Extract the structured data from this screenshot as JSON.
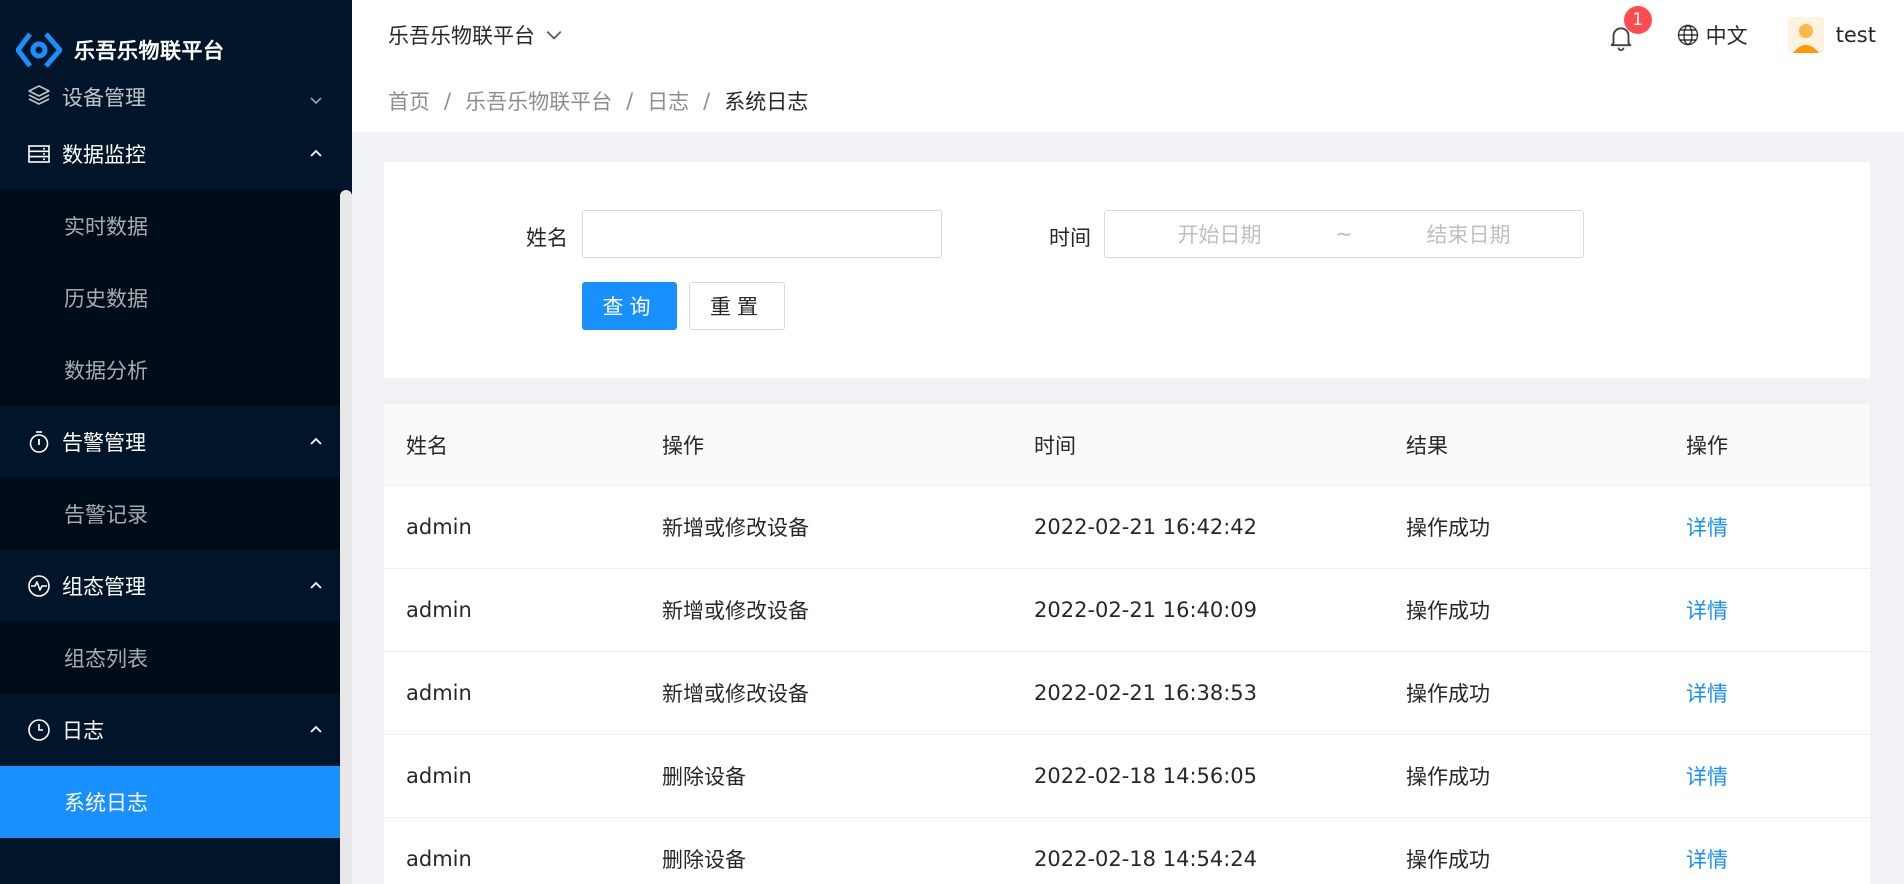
{
  "app": {
    "name": "乐吾乐物联平台"
  },
  "sidebar": {
    "groups": [
      {
        "label": "设备管理",
        "icon": "layers-icon",
        "open": false,
        "items": []
      },
      {
        "label": "数据监控",
        "icon": "database-icon",
        "open": true,
        "items": [
          {
            "label": "实时数据"
          },
          {
            "label": "历史数据"
          },
          {
            "label": "数据分析"
          }
        ]
      },
      {
        "label": "告警管理",
        "icon": "alert-icon",
        "open": true,
        "items": [
          {
            "label": "告警记录"
          }
        ]
      },
      {
        "label": "组态管理",
        "icon": "heartbeat-icon",
        "open": true,
        "items": [
          {
            "label": "组态列表"
          }
        ]
      },
      {
        "label": "日志",
        "icon": "clock-icon",
        "open": true,
        "items": [
          {
            "label": "系统日志",
            "active": true
          }
        ]
      }
    ]
  },
  "header": {
    "title": "乐吾乐物联平台",
    "notification_count": "1",
    "language": "中文",
    "username": "test"
  },
  "breadcrumb": [
    "首页",
    "乐吾乐物联平台",
    "日志",
    "系统日志"
  ],
  "breadcrumb_separator": "/",
  "search": {
    "name_label": "姓名",
    "name_value": "",
    "time_label": "时间",
    "start_placeholder": "开始日期",
    "range_separator": "~",
    "end_placeholder": "结束日期",
    "query_label": "查询",
    "reset_label": "重置"
  },
  "table": {
    "columns": [
      "姓名",
      "操作",
      "时间",
      "结果",
      "操作"
    ],
    "rows": [
      {
        "name": "admin",
        "action": "新增或修改设备",
        "time": "2022-02-21 16:42:42",
        "result": "操作成功",
        "link": "详情"
      },
      {
        "name": "admin",
        "action": "新增或修改设备",
        "time": "2022-02-21 16:40:09",
        "result": "操作成功",
        "link": "详情"
      },
      {
        "name": "admin",
        "action": "新增或修改设备",
        "time": "2022-02-21 16:38:53",
        "result": "操作成功",
        "link": "详情"
      },
      {
        "name": "admin",
        "action": "删除设备",
        "time": "2022-02-18 14:56:05",
        "result": "操作成功",
        "link": "详情"
      },
      {
        "name": "admin",
        "action": "删除设备",
        "time": "2022-02-18 14:54:24",
        "result": "操作成功",
        "link": "详情"
      }
    ]
  },
  "colors": {
    "primary": "#1890ff",
    "sidebar_bg": "#001529",
    "submenu_bg": "#000c17",
    "badge": "#ff4d4f"
  }
}
